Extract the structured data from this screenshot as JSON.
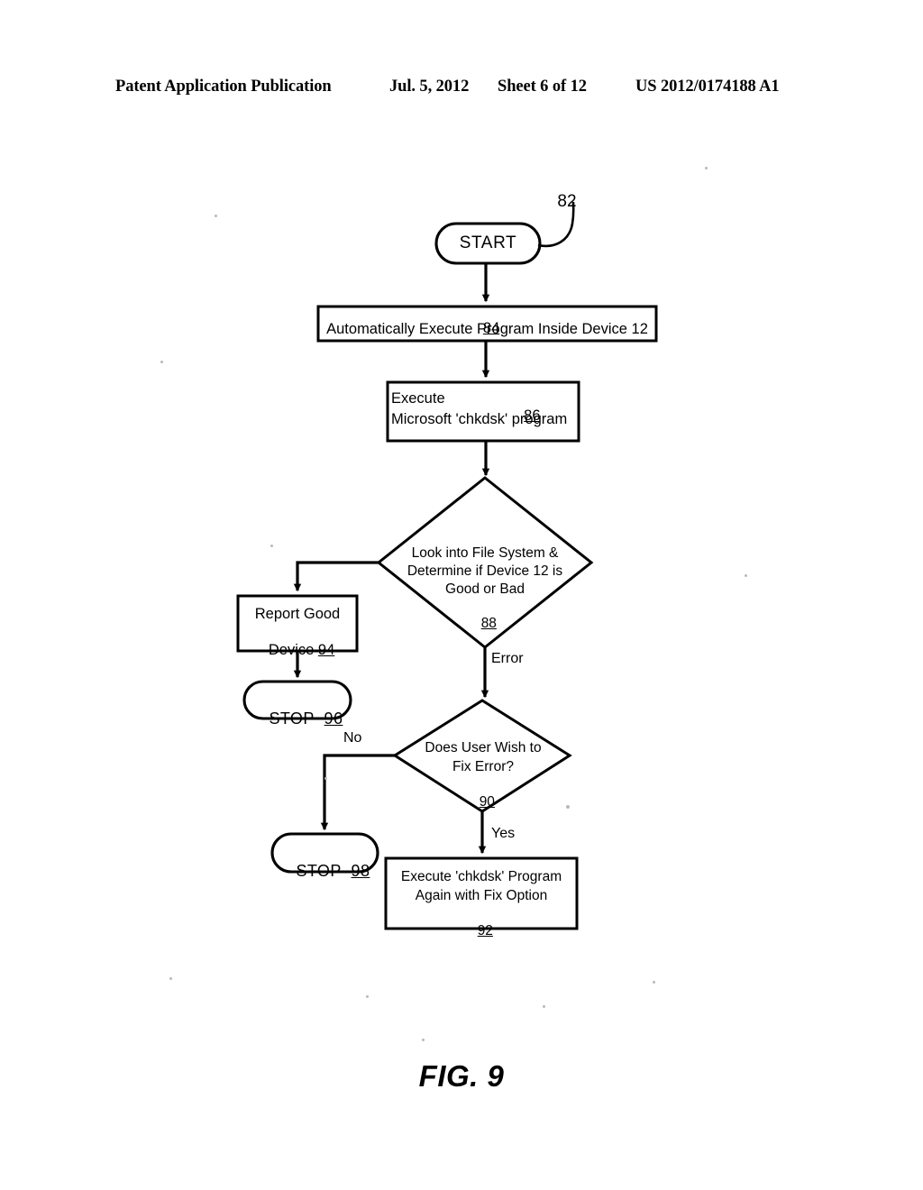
{
  "header": {
    "publication": "Patent Application Publication",
    "date": "Jul. 5, 2012",
    "sheet": "Sheet 6 of 12",
    "patent_number": "US 2012/0174188 A1"
  },
  "figure": {
    "caption": "FIG. 9",
    "lead_label": "82"
  },
  "nodes": {
    "start": {
      "label": "START",
      "ref": "82",
      "shape": "terminator"
    },
    "step84": {
      "ref": "84",
      "line1": "Automatically Execute Program Inside Device 12",
      "shape": "process"
    },
    "step86": {
      "ref": "86",
      "line1": "Execute",
      "line2": "Microsoft 'chkdsk' program",
      "shape": "process"
    },
    "decision88": {
      "ref": "88",
      "line1": "Look into File System &",
      "line2": "Determine if Device 12 is",
      "line3": "Good or Bad",
      "shape": "decision"
    },
    "step94": {
      "ref": "94",
      "line1": "Report Good",
      "line2": "Device",
      "shape": "process"
    },
    "stop96": {
      "label": "STOP",
      "ref": "96",
      "shape": "terminator"
    },
    "decision90": {
      "ref": "90",
      "line1": "Does User Wish to",
      "line2": "Fix Error?",
      "shape": "decision"
    },
    "stop98": {
      "label": "STOP",
      "ref": "98",
      "shape": "terminator"
    },
    "step92": {
      "ref": "92",
      "line1": "Execute 'chkdsk' Program",
      "line2": "Again with Fix Option",
      "shape": "process"
    }
  },
  "edge_labels": {
    "error": "Error",
    "no": "No",
    "yes": "Yes"
  },
  "colors": {
    "ink": "#000000",
    "page": "#ffffff"
  }
}
